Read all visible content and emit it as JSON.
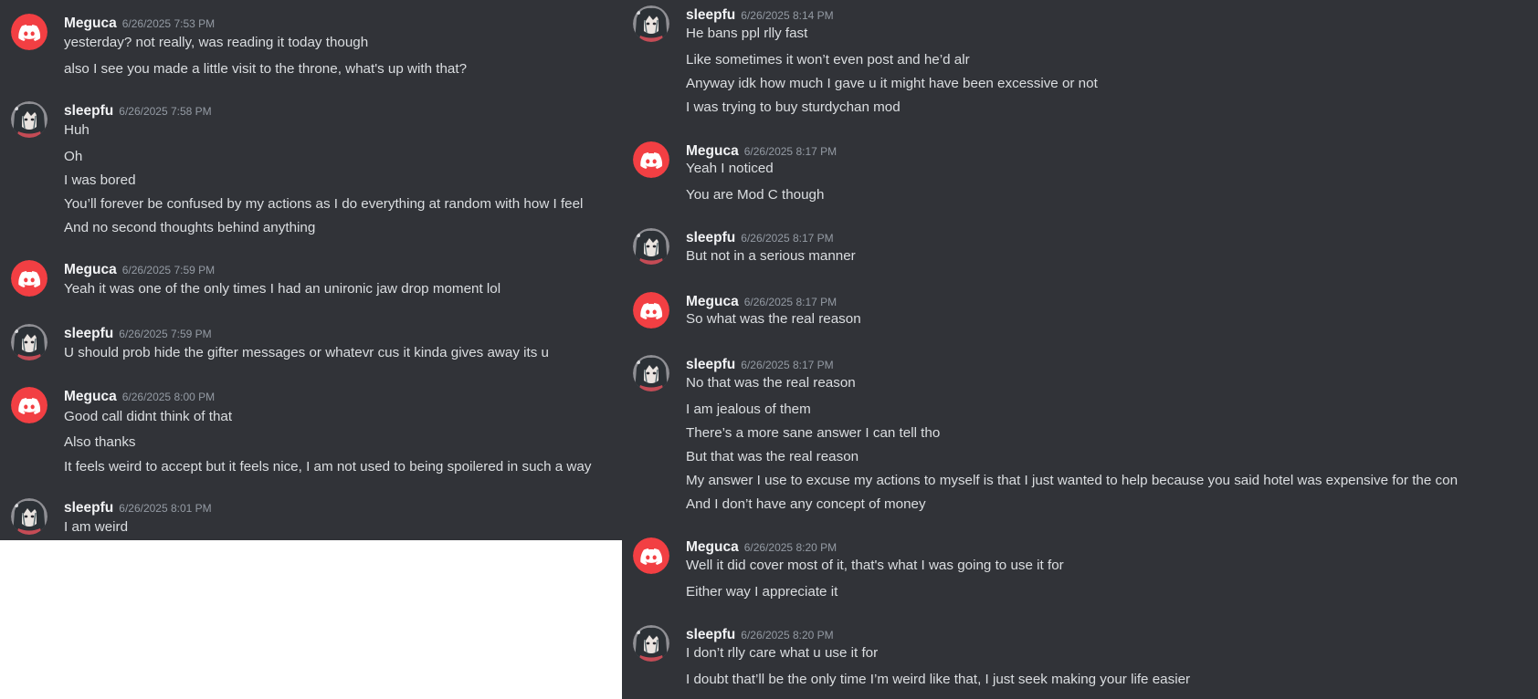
{
  "colors": {
    "background": "#313338",
    "username": "#f2f3f5",
    "timestamp": "#949ba4",
    "message": "#dbdee1",
    "discord_avatar_red": "#f23f43"
  },
  "avatars": {
    "meguca": "discord-logo-icon",
    "sleepfu": "anime-character-avatar"
  },
  "left_panel": {
    "groups": [
      {
        "author": "Meguca",
        "timestamp": "6/26/2025 7:53 PM",
        "lines": [
          "yesterday? not really, was reading it today though",
          "also I see you made a little visit to the throne, what's up with that?"
        ]
      },
      {
        "author": "sleepfu",
        "timestamp": "6/26/2025 7:58 PM",
        "lines": [
          "Huh",
          "Oh",
          "I was bored",
          "You’ll forever be confused by my actions as I do everything at random with how I feel",
          "And no second thoughts behind anything"
        ]
      },
      {
        "author": "Meguca",
        "timestamp": "6/26/2025 7:59 PM",
        "lines": [
          "Yeah it was one of the only times I had an unironic jaw drop moment lol"
        ]
      },
      {
        "author": "sleepfu",
        "timestamp": "6/26/2025 7:59 PM",
        "lines": [
          "U should prob hide the gifter messages or whatevr cus it kinda gives away its u"
        ]
      },
      {
        "author": "Meguca",
        "timestamp": "6/26/2025 8:00 PM",
        "lines": [
          "Good call didnt think of that",
          "Also thanks",
          "It feels weird to accept but it feels nice, I am not used to being spoilered in such a way"
        ]
      },
      {
        "author": "sleepfu",
        "timestamp": "6/26/2025 8:01 PM",
        "lines": [
          "I am weird"
        ]
      }
    ]
  },
  "right_panel": {
    "groups": [
      {
        "author": "sleepfu",
        "timestamp": "6/26/2025 8:14 PM",
        "lines": [
          "He bans ppl rlly fast",
          "Like sometimes it won’t even post and he’d alr",
          "Anyway idk how much I gave u it might have been excessive or not",
          "I was trying to buy sturdychan mod"
        ]
      },
      {
        "author": "Meguca",
        "timestamp": "6/26/2025 8:17 PM",
        "lines": [
          "Yeah I noticed",
          "You are Mod C though"
        ]
      },
      {
        "author": "sleepfu",
        "timestamp": "6/26/2025 8:17 PM",
        "lines": [
          "But not in a serious manner"
        ]
      },
      {
        "author": "Meguca",
        "timestamp": "6/26/2025 8:17 PM",
        "lines": [
          "So what was the real reason"
        ]
      },
      {
        "author": "sleepfu",
        "timestamp": "6/26/2025 8:17 PM",
        "lines": [
          "No that was the real reason",
          "I am jealous of them",
          "There’s a more sane answer I can tell tho",
          "But that was the real reason",
          "My answer I use to excuse my actions to myself is that I just wanted to help because you said hotel was expensive for the con",
          "And I don’t have any concept of money"
        ]
      },
      {
        "author": "Meguca",
        "timestamp": "6/26/2025 8:20 PM",
        "lines": [
          "Well it did cover most of it, that's what I was going to use it for",
          "Either way I appreciate it"
        ]
      },
      {
        "author": "sleepfu",
        "timestamp": "6/26/2025 8:20 PM",
        "lines": [
          "I don’t rlly care what u use it for",
          "I doubt that’ll be the only time I’m weird like that, I just seek making your life easier"
        ]
      }
    ]
  }
}
